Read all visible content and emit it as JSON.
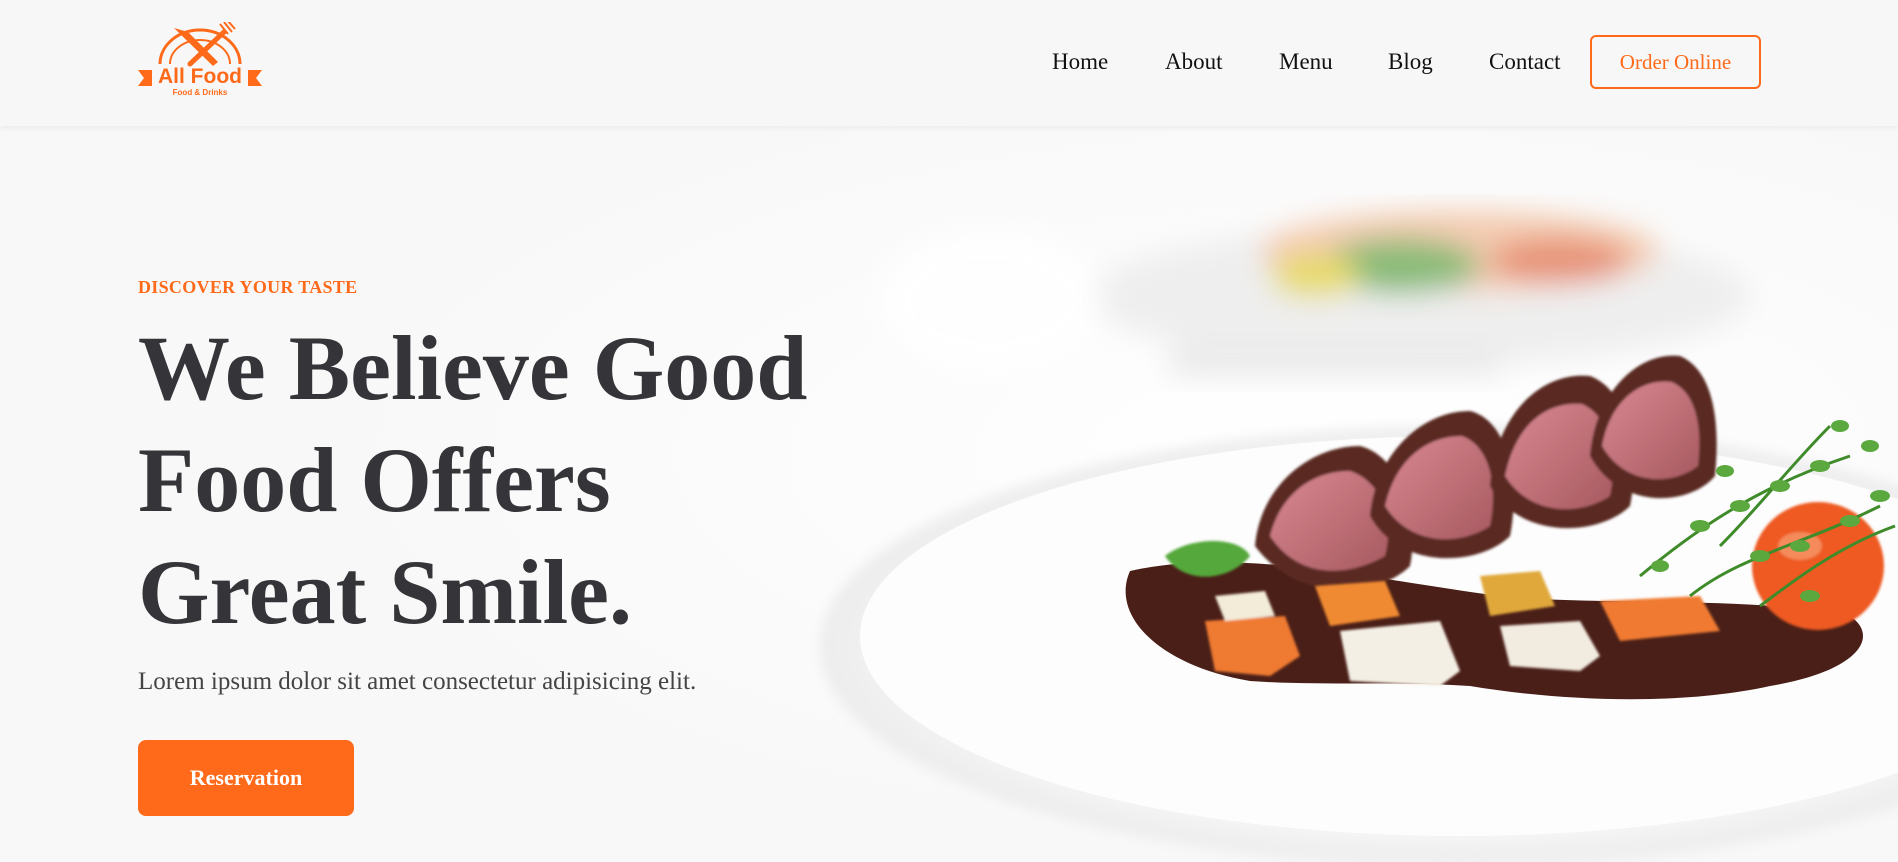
{
  "brand": {
    "name": "All Food",
    "tagline": "Food & Drinks",
    "accent_color": "#ff6a1a",
    "logo_icon": "crossed-fork-knife-icon"
  },
  "nav": {
    "items": [
      {
        "label": "Home"
      },
      {
        "label": "About"
      },
      {
        "label": "Menu"
      },
      {
        "label": "Blog"
      },
      {
        "label": "Contact"
      }
    ],
    "cta_label": "Order Online"
  },
  "hero": {
    "kicker": "DISCOVER YOUR TASTE",
    "headline_lines": [
      "We Believe Good",
      "Food Offers",
      "Great Smile."
    ],
    "lead": "Lorem ipsum dolor sit amet consectetur adipisicing elit.",
    "button_label": "Reservation",
    "headline_color": "#353438"
  }
}
